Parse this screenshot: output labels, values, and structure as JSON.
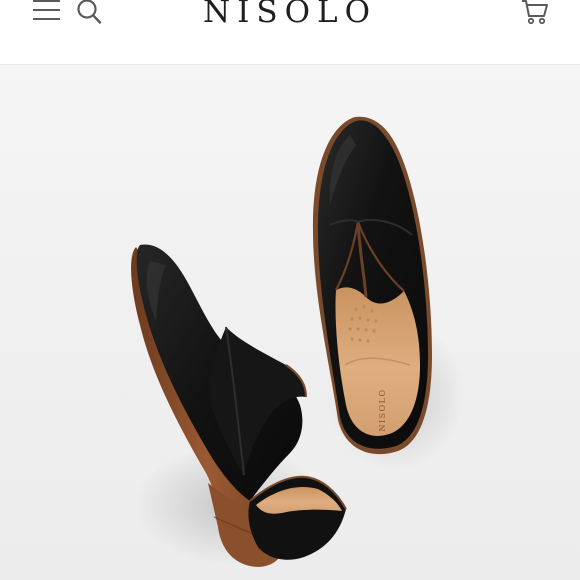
{
  "header": {
    "brand_name": "NISOLO",
    "icons": {
      "menu": "menu-icon",
      "search": "search-icon",
      "cart": "cart-icon"
    }
  },
  "hero": {
    "insole_brand": "NISOLO",
    "colors": {
      "leather": "#141414",
      "sole": "#8a4a2a",
      "insole": "#d9a97c",
      "background": "#f2f2f2"
    }
  }
}
